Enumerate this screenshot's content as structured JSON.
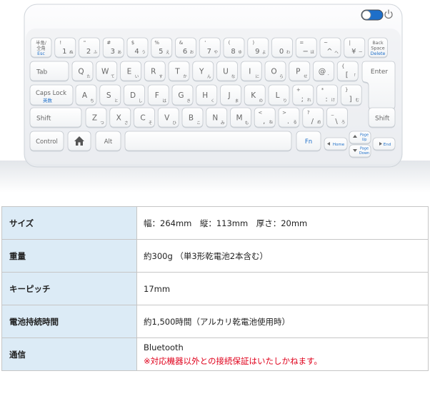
{
  "keyboard": {
    "rows": [
      [
        {
          "name": "key-hankaku",
          "type": "small",
          "lines": [
            "半角/",
            "全角",
            "Esc"
          ]
        },
        {
          "name": "key-1",
          "type": "num",
          "top": "!",
          "main": "1",
          "kana": "ぬ"
        },
        {
          "name": "key-2",
          "type": "num",
          "top": "\"",
          "main": "2",
          "kana": "ふ"
        },
        {
          "name": "key-3",
          "type": "num",
          "top": "#",
          "main": "3",
          "kana": "あ"
        },
        {
          "name": "key-4",
          "type": "num",
          "top": "$",
          "main": "4",
          "kana": "う"
        },
        {
          "name": "key-5",
          "type": "num",
          "top": "%",
          "main": "5",
          "kana": "え"
        },
        {
          "name": "key-6",
          "type": "num",
          "top": "&",
          "main": "6",
          "kana": "お"
        },
        {
          "name": "key-7",
          "type": "num",
          "top": "'",
          "main": "7",
          "kana": "や"
        },
        {
          "name": "key-8",
          "type": "num",
          "top": "(",
          "main": "8",
          "kana": "ゆ"
        },
        {
          "name": "key-9",
          "type": "num",
          "top": ")",
          "main": "9",
          "kana": "よ"
        },
        {
          "name": "key-0",
          "type": "num",
          "top": "",
          "main": "0",
          "kana": "わ"
        },
        {
          "name": "key-minus",
          "type": "num",
          "top": "=",
          "main": "−",
          "kana": "ほ"
        },
        {
          "name": "key-caret",
          "type": "num",
          "top": "~",
          "main": "^",
          "kana": "へ"
        },
        {
          "name": "key-yen",
          "type": "num",
          "top": "|",
          "main": "¥",
          "kana": "ー"
        },
        {
          "name": "key-backspace",
          "type": "small",
          "lines": [
            "Back",
            "Space",
            "Delete"
          ]
        }
      ],
      [
        {
          "name": "key-tab",
          "type": "label",
          "main": "Tab"
        },
        {
          "name": "key-q",
          "type": "letter",
          "main": "Q",
          "kana": "た"
        },
        {
          "name": "key-w",
          "type": "letter",
          "main": "W",
          "kana": "て"
        },
        {
          "name": "key-e",
          "type": "letter",
          "main": "E",
          "kana": "い"
        },
        {
          "name": "key-r",
          "type": "letter",
          "main": "R",
          "kana": "す"
        },
        {
          "name": "key-t",
          "type": "letter",
          "main": "T",
          "kana": "か"
        },
        {
          "name": "key-y",
          "type": "letter",
          "main": "Y",
          "kana": "ん"
        },
        {
          "name": "key-u",
          "type": "letter",
          "main": "U",
          "kana": "な"
        },
        {
          "name": "key-i",
          "type": "letter",
          "main": "I",
          "kana": "に"
        },
        {
          "name": "key-o",
          "type": "letter",
          "main": "O",
          "kana": "ら"
        },
        {
          "name": "key-p",
          "type": "letter",
          "main": "P",
          "kana": "せ"
        },
        {
          "name": "key-at",
          "type": "letter",
          "main": "@",
          "kana": "゛"
        },
        {
          "name": "key-bracket-open",
          "type": "num",
          "top": "{",
          "main": "[",
          "kana": "「"
        }
      ],
      [
        {
          "name": "key-capslock",
          "type": "caps",
          "lines": [
            "Caps Lock",
            "英数"
          ]
        },
        {
          "name": "key-a",
          "type": "letter",
          "main": "A",
          "kana": "ち"
        },
        {
          "name": "key-s",
          "type": "letter",
          "main": "S",
          "kana": "と"
        },
        {
          "name": "key-d",
          "type": "letter",
          "main": "D",
          "kana": "し"
        },
        {
          "name": "key-f",
          "type": "letter",
          "main": "F",
          "kana": "は"
        },
        {
          "name": "key-g",
          "type": "letter",
          "main": "G",
          "kana": "き"
        },
        {
          "name": "key-h",
          "type": "letter",
          "main": "H",
          "kana": "く"
        },
        {
          "name": "key-j",
          "type": "letter",
          "main": "J",
          "kana": "ま"
        },
        {
          "name": "key-k",
          "type": "letter",
          "main": "K",
          "kana": "の"
        },
        {
          "name": "key-l",
          "type": "letter",
          "main": "L",
          "kana": "り"
        },
        {
          "name": "key-semicolon",
          "type": "num",
          "top": "+",
          "main": ";",
          "kana": "れ"
        },
        {
          "name": "key-colon",
          "type": "num",
          "top": "*",
          "main": ":",
          "kana": "け"
        },
        {
          "name": "key-bracket-close",
          "type": "num",
          "top": "}",
          "main": "]",
          "kana": "む"
        }
      ],
      [
        {
          "name": "key-shift-left",
          "type": "label",
          "main": "Shift"
        },
        {
          "name": "key-z",
          "type": "letter",
          "main": "Z",
          "kana": "つ"
        },
        {
          "name": "key-x",
          "type": "letter",
          "main": "X",
          "kana": "さ"
        },
        {
          "name": "key-c",
          "type": "letter",
          "main": "C",
          "kana": "そ"
        },
        {
          "name": "key-v",
          "type": "letter",
          "main": "V",
          "kana": "ひ"
        },
        {
          "name": "key-b",
          "type": "letter",
          "main": "B",
          "kana": "こ"
        },
        {
          "name": "key-n",
          "type": "letter",
          "main": "N",
          "kana": "み"
        },
        {
          "name": "key-m",
          "type": "letter",
          "main": "M",
          "kana": "も"
        },
        {
          "name": "key-comma",
          "type": "num",
          "top": "<",
          "main": ",",
          "kana": "ね"
        },
        {
          "name": "key-period",
          "type": "num",
          "top": ">",
          "main": ".",
          "kana": "る"
        },
        {
          "name": "key-slash",
          "type": "num",
          "top": "?",
          "main": "/",
          "kana": "め"
        },
        {
          "name": "key-backslash",
          "type": "num",
          "top": "_",
          "main": "\\",
          "kana": "ろ"
        },
        {
          "name": "key-shift-right",
          "type": "label",
          "main": "Shift"
        }
      ]
    ],
    "enter_label": "Enter",
    "bottom": {
      "control": "Control",
      "home_icon": "home-icon",
      "alt": "Alt",
      "fn": "Fn",
      "home": "Home",
      "page_up": [
        "Page",
        "Up"
      ],
      "page_down": [
        "Page",
        "Down"
      ],
      "end": "End"
    },
    "colors": {
      "body": "#f2f4f6",
      "key": "#ffffff",
      "key_text": "#666666",
      "accent": "#1e6fc9",
      "power": "#7a7a7a"
    }
  },
  "specs": [
    {
      "label": "サイズ",
      "value": "幅：264mm　縦：113mm　厚さ：20mm"
    },
    {
      "label": "重量",
      "value": "約300g （単3形乾電池2本含む）"
    },
    {
      "label": "キーピッチ",
      "value": "17mm"
    },
    {
      "label": "電池持続時間",
      "value": "約1,500時間（アルカリ乾電池使用時）"
    },
    {
      "label": "通信",
      "value": "Bluetooth",
      "note": "※対応機器以外との接続保証はいたしかねます。"
    }
  ]
}
